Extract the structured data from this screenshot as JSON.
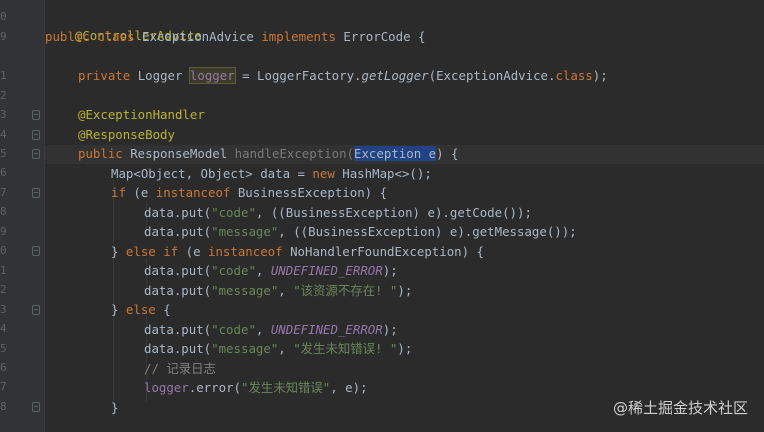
{
  "gutter": {
    "line_numbers": [
      "0",
      "9",
      "",
      "1",
      "2",
      "3",
      "4",
      "5",
      "6",
      "7",
      "8",
      "9",
      "0",
      "1",
      "2",
      "3",
      "4",
      "5",
      "6",
      "7",
      "8",
      ""
    ]
  },
  "code": {
    "l1": "@ControllerAdvice",
    "l2_a": "public class ",
    "l2_b": "ExceptionAdvice ",
    "l2_c": "implements ",
    "l2_d": "ErrorCode {",
    "l4_a": "private ",
    "l4_b": "Logger ",
    "l4_c": "logger",
    "l4_d": " = LoggerFactory.",
    "l4_e": "getLogger",
    "l4_f": "(ExceptionAdvice.",
    "l4_g": "class",
    "l4_h": ");",
    "l6": "@ExceptionHandler",
    "l7": "@ResponseBody",
    "l8_a": "public ",
    "l8_b": "ResponseModel ",
    "l8_c": "handleException(",
    "l8_d": "Exception e",
    "l8_e": ") {",
    "l9_a": "Map<Object, Object> data = ",
    "l9_b": "new ",
    "l9_c": "HashMap<>();",
    "l10_a": "if ",
    "l10_b": "(e ",
    "l10_c": "instanceof ",
    "l10_d": "BusinessException) {",
    "l11_a": "data.put(",
    "l11_b": "\"code\"",
    "l11_c": ", ((BusinessException) e).getCode());",
    "l12_a": "data.put(",
    "l12_b": "\"message\"",
    "l12_c": ", ((BusinessException) e).getMessage());",
    "l13_a": "} ",
    "l13_b": "else if ",
    "l13_c": "(e ",
    "l13_d": "instanceof ",
    "l13_e": "NoHandlerFoundException) {",
    "l14_a": "data.put(",
    "l14_b": "\"code\"",
    "l14_c": ", ",
    "l14_d": "UNDEFINED_ERROR",
    "l14_e": ");",
    "l15_a": "data.put(",
    "l15_b": "\"message\"",
    "l15_c": ", ",
    "l15_d": "\"该资源不存在! \"",
    "l15_e": ");",
    "l16_a": "} ",
    "l16_b": "else ",
    "l16_c": "{",
    "l17_a": "data.put(",
    "l17_b": "\"code\"",
    "l17_c": ", ",
    "l17_d": "UNDEFINED_ERROR",
    "l17_e": ");",
    "l18_a": "data.put(",
    "l18_b": "\"message\"",
    "l18_c": ", ",
    "l18_d": "\"发生未知错误! \"",
    "l18_e": ");",
    "l19": "// 记录日志",
    "l20_a": "logger",
    "l20_b": ".error(",
    "l20_c": "\"发生未知错误\"",
    "l20_d": ", e);",
    "l21": "}"
  },
  "watermark": "@稀土掘金技术社区",
  "colors": {
    "background": "#2b2b2b",
    "keyword": "#cc7832",
    "annotation": "#bbb529",
    "string": "#6a8759",
    "constant": "#9876aa",
    "text": "#a9b7c6"
  }
}
